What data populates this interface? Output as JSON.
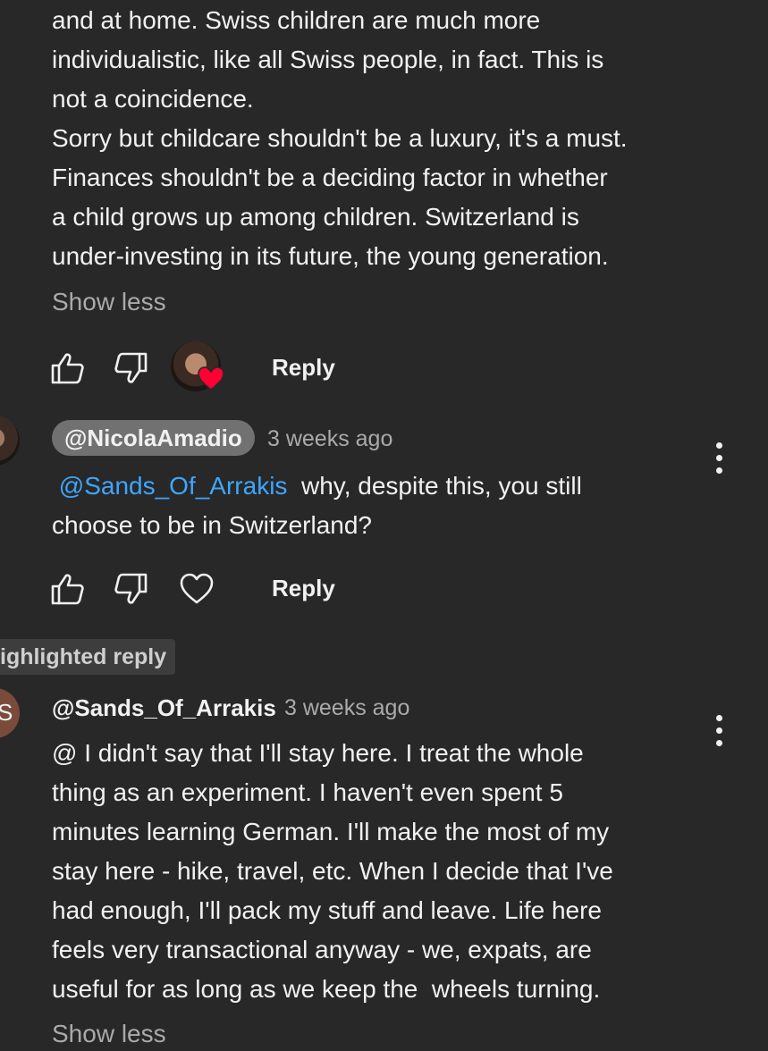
{
  "comment_top": {
    "lines": [
      "and at home. Swiss children are much more",
      "individualistic, like all Swiss people, in fact. This is",
      "not a coincidence.",
      "Sorry but childcare shouldn't be a luxury, it's a must.",
      "Finances shouldn't be a deciding factor in whether",
      "a child grows up among children. Switzerland is",
      "under-investing in its future, the young generation."
    ],
    "show_less_label": "Show less",
    "reply_label": "Reply"
  },
  "reply_1": {
    "author": "@NicolaAmadio",
    "timestamp": "3 weeks ago",
    "mention": "@Sands_Of_Arrakis",
    "text_after_mention": "why, despite this, you still",
    "text_line2": "choose to be in Switzerland?",
    "reply_label": "Reply"
  },
  "highlight_badge": "ighlighted reply",
  "reply_2": {
    "author": "@Sands_Of_Arrakis",
    "timestamp": "3 weeks ago",
    "avatar_letter": "S",
    "lines": [
      "@ I didn't say that I'll stay here. I treat the whole",
      "thing as an experiment. I haven't even spent 5",
      "minutes learning German. I'll make the most of my",
      "stay here - hike, travel, etc. When I decide that I've",
      "had enough, I'll pack my stuff and leave. Life here",
      "feels very transactional anyway - we, expats, are",
      "useful for as long as we keep the  wheels turning."
    ],
    "show_less_label": "Show less"
  },
  "colors": {
    "background": "#282828",
    "mention": "#3ea6ff",
    "heart": "#ff0033",
    "chip": "#717171",
    "avatar_s": "#7a4a3a"
  }
}
